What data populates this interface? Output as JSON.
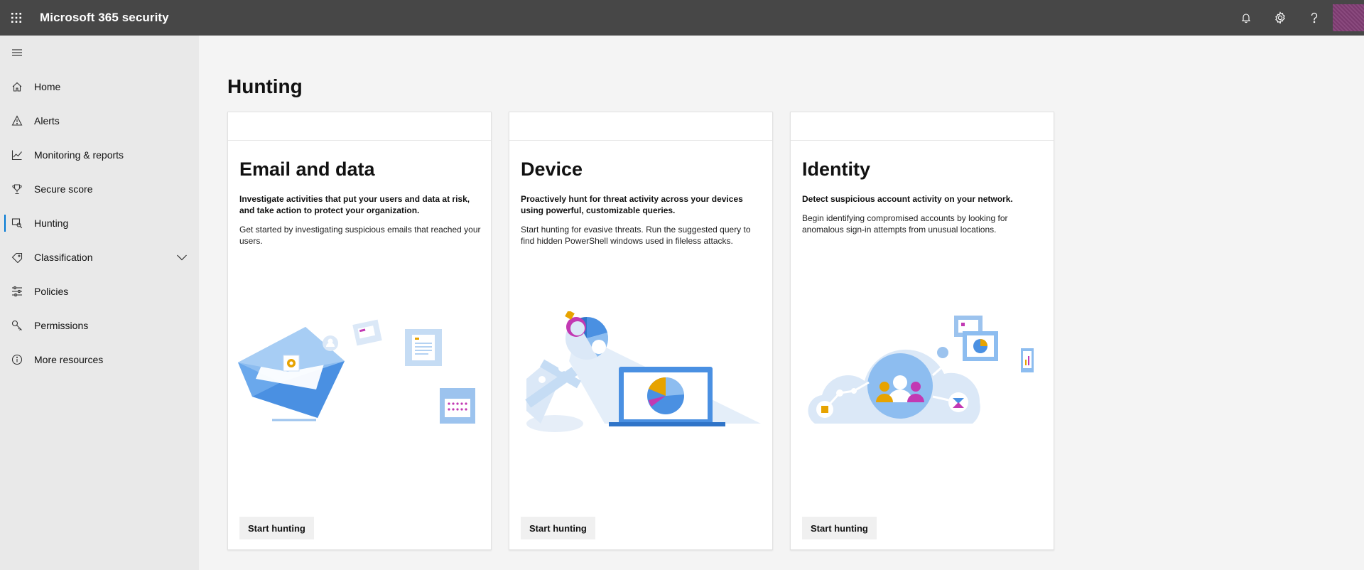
{
  "header": {
    "app_title": "Microsoft 365 security",
    "icons": [
      "waffle-icon",
      "bell-icon",
      "gear-icon",
      "help-icon",
      "avatar"
    ]
  },
  "sidebar": {
    "items": [
      {
        "label": "Home",
        "icon": "home-icon"
      },
      {
        "label": "Alerts",
        "icon": "alert-icon"
      },
      {
        "label": "Monitoring & reports",
        "icon": "chart-icon"
      },
      {
        "label": "Secure score",
        "icon": "trophy-icon"
      },
      {
        "label": "Hunting",
        "icon": "hunting-icon",
        "active": true
      },
      {
        "label": "Classification",
        "icon": "tag-icon",
        "expandable": true
      },
      {
        "label": "Policies",
        "icon": "sliders-icon"
      },
      {
        "label": "Permissions",
        "icon": "key-icon"
      },
      {
        "label": "More resources",
        "icon": "info-icon"
      }
    ]
  },
  "main": {
    "title": "Hunting",
    "cards": [
      {
        "title": "Email and data",
        "lead": "Investigate activities that put your users and data at risk, and take action to protect your organization.",
        "body": "Get started by investigating suspicious emails that reached your users.",
        "button": "Start hunting"
      },
      {
        "title": "Device",
        "lead": "Proactively hunt for threat activity across your devices using powerful, customizable queries.",
        "body": "Start hunting for evasive threats. Run the suggested query to find hidden PowerShell windows used in fileless attacks.",
        "button": "Start hunting"
      },
      {
        "title": "Identity",
        "lead": "Detect suspicious account activity on your network.",
        "body": "Begin identifying compromised accounts by looking for anomalous sign-in attempts from unusual locations.",
        "button": "Start hunting"
      }
    ]
  },
  "colors": {
    "topbar": "#474747",
    "sidebar": "#e9e9e9",
    "accent": "#0078d4",
    "illustration_blue": "#5a9be6",
    "illustration_light": "#dbe8f7"
  }
}
